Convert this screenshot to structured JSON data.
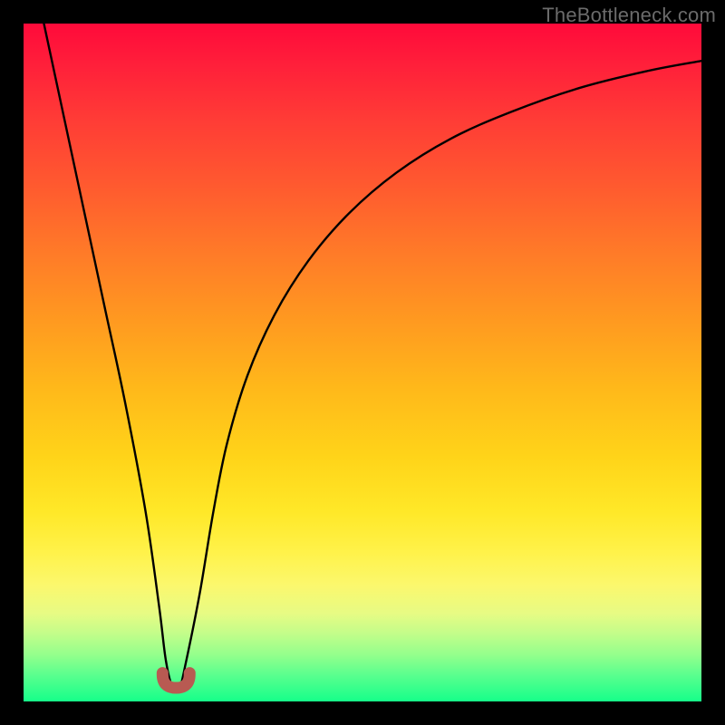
{
  "watermark": "TheBottleneck.com",
  "chart_data": {
    "type": "line",
    "title": "",
    "xlabel": "",
    "ylabel": "",
    "xlim": [
      0,
      100
    ],
    "ylim": [
      0,
      100
    ],
    "grid": false,
    "legend": false,
    "series": [
      {
        "name": "bottleneck-curve",
        "x": [
          3,
          6,
          9,
          12,
          15,
          18,
          20,
          21,
          22,
          23,
          24,
          26,
          28,
          30,
          33,
          37,
          42,
          48,
          55,
          63,
          72,
          82,
          92,
          100
        ],
        "y": [
          100,
          86,
          72,
          58,
          44,
          28,
          14,
          6,
          2,
          2,
          6,
          16,
          28,
          38,
          48,
          57,
          65,
          72,
          78,
          83,
          87,
          90.5,
          93,
          94.5
        ]
      }
    ],
    "marker": {
      "name": "minimum-marker",
      "x_range": [
        20.5,
        24.5
      ],
      "y": 2,
      "color": "#b85a52"
    },
    "background_gradient": {
      "top": "#ff0a3a",
      "bottom": "#16ff8a"
    }
  }
}
